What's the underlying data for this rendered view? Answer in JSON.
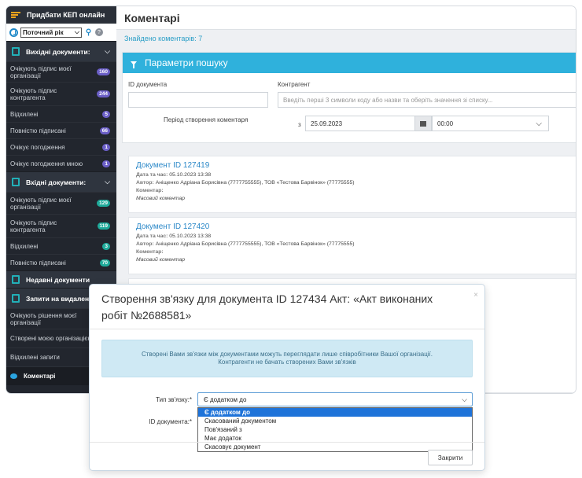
{
  "sidebar": {
    "top_label": "Придбати КЕП онлайн",
    "period_value": "Поточний рік",
    "section_outgoing": "Вихідні документи:",
    "outgoing_items": [
      {
        "label": "Очікують підпис моєї організації",
        "count": "160"
      },
      {
        "label": "Очікують підпис контрагента",
        "count": "244"
      },
      {
        "label": "Відхилені",
        "count": "5"
      },
      {
        "label": "Повністю підписані",
        "count": "66"
      },
      {
        "label": "Очікує погодження",
        "count": "1"
      },
      {
        "label": "Очікує погодження мною",
        "count": "1"
      }
    ],
    "section_incoming": "Вхідні документи:",
    "incoming_items": [
      {
        "label": "Очікують підпис моєї організації",
        "count": "129"
      },
      {
        "label": "Очікують підпис контрагента",
        "count": "119"
      },
      {
        "label": "Відхилені",
        "count": "3"
      },
      {
        "label": "Повністю підписані",
        "count": "70"
      }
    ],
    "section_recent": "Недавні документи",
    "section_deletion": "Запити на видалення",
    "deletion_items": [
      {
        "label": "Очікують рішення моєї організації"
      },
      {
        "label": "Створені моєю організацією"
      },
      {
        "label": "Відхилені запити"
      }
    ],
    "comments_label": "Коментарі"
  },
  "main": {
    "title": "Коментарі",
    "found_text": "Знайдено коментарів: 7",
    "search": {
      "header": "Параметри пошуку",
      "doc_id_label": "ID документа",
      "contractor_label": "Контрагент",
      "contractor_placeholder": "Введіть перші 3 символи коду або назви та оберіть значення зі списку...",
      "period_label": "Період створення коментаря",
      "from_label": "з",
      "date_value": "25.09.2023",
      "time_value": "00:00"
    },
    "documents": [
      {
        "title": "Документ ID 127419",
        "datetime_label": "Дата та час:",
        "datetime": "05.10.2023 13:38",
        "author_label": "Автор:",
        "author": "Аніщенко Адріана Борисівна (7777755555), ТОВ «Тестова Барвінок» (77775555)",
        "comment_label": "Коментар:",
        "comment": "Масовий коментар"
      },
      {
        "title": "Документ ID 127420",
        "datetime_label": "Дата та час:",
        "datetime": "05.10.2023 13:38",
        "author_label": "Автор:",
        "author": "Аніщенко Адріана Борисівна (7777755555), ТОВ «Тестова Барвінок» (77775555)",
        "comment_label": "Коментар:",
        "comment": "Масовий коментар"
      }
    ]
  },
  "modal": {
    "title": "Створення зв'язку для документа ID 127434 Акт: «Акт виконаних робіт №2688581»",
    "close_symbol": "×",
    "info_line1": "Створені Вами зв'язки між документами можуть переглядати лише співробітники Вашої організації.",
    "info_line2": "Контрагенти не бачать створених Вами зв'язків",
    "link_type_label": "Тип зв'язку:*",
    "doc_id_label": "ID документа:*",
    "selected_value": "Є додатком до",
    "options": [
      "Є додатком до",
      "Скасований документом",
      "Пов'язаний з",
      "Має додаток",
      "Скасовує документ"
    ],
    "close_button": "Закрити"
  }
}
